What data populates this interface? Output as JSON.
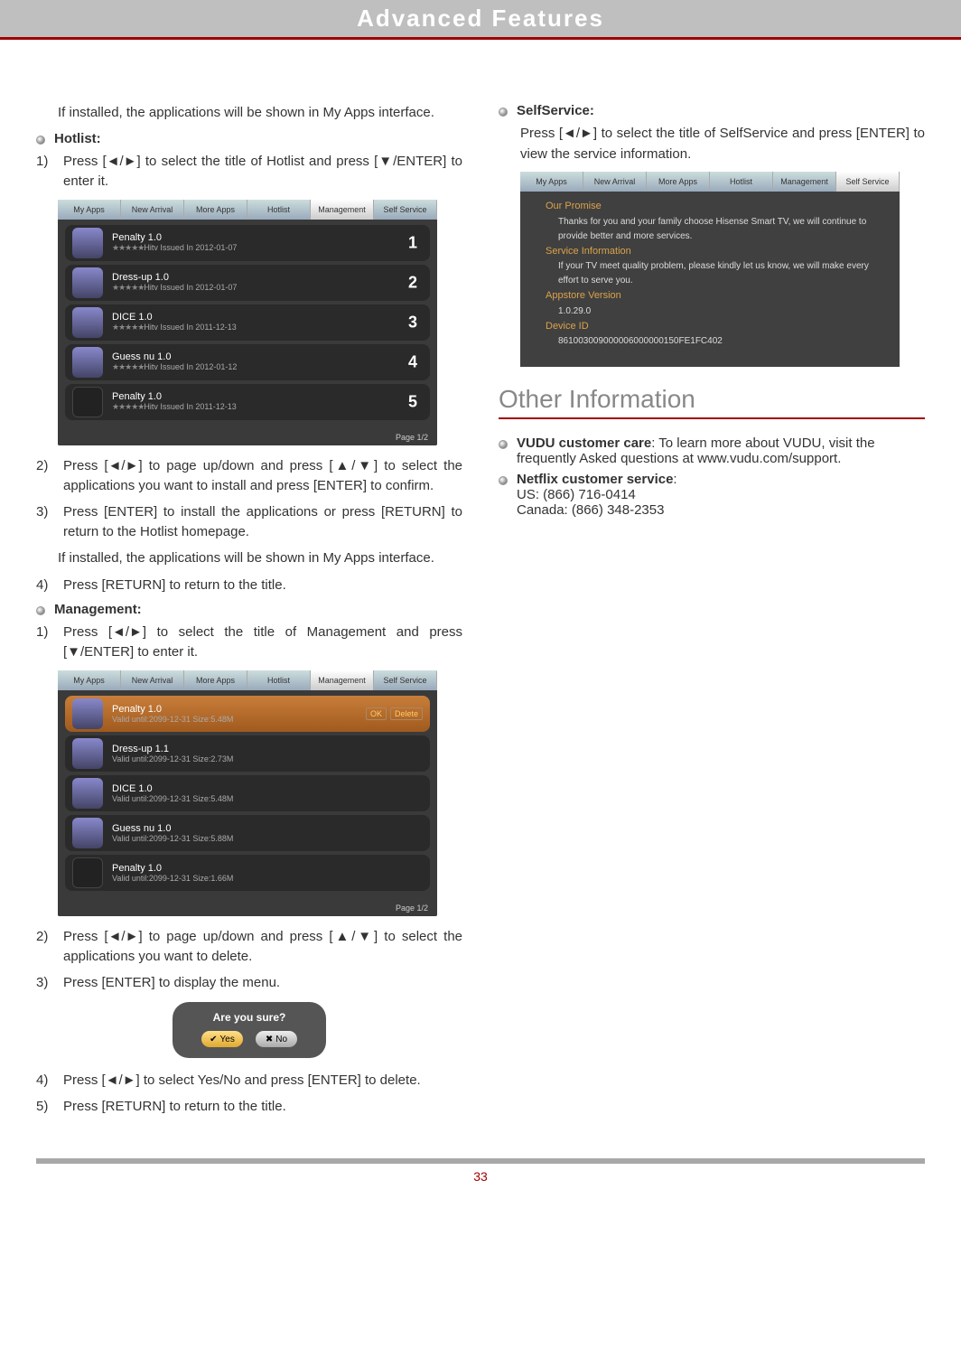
{
  "header": {
    "title": "Advanced Features"
  },
  "col1": {
    "intro": "If installed, the applications will be shown in My Apps interface.",
    "hotlist_label": "Hotlist:",
    "hotlist_step1": "Press [◄/►] to select the title of Hotlist and press [▼/ENTER] to enter it.",
    "hotlist_step2": "Press [◄/►] to page up/down and press [▲/▼] to select the applications you want to install and press [ENTER] to confirm.",
    "hotlist_step3": "Press [ENTER] to install the applications or press [RETURN] to return to the Hotlist homepage.",
    "hotlist_note": "If installed, the applications will be shown in My Apps interface.",
    "hotlist_step4": "Press [RETURN] to return to the title.",
    "mgmt_label": "Management:",
    "mgmt_step1": "Press [◄/►] to select the title of Management and press [▼/ENTER] to enter it.",
    "mgmt_step2": "Press [◄/►] to page up/down and press [▲/▼] to select the applications you want to delete.",
    "mgmt_step3": "Press [ENTER] to display the menu.",
    "mgmt_step4": "Press [◄/►] to select Yes/No and press [ENTER] to delete.",
    "mgmt_step5": "Press [RETURN] to return to the title."
  },
  "tabs": {
    "t1": "My Apps",
    "t2": "New Arrival",
    "t3": "More Apps",
    "t4": "Hotlist",
    "t5": "Management",
    "t6": "Self Service"
  },
  "hotlist_apps": [
    {
      "name": "Penalty  1.0",
      "meta": "Hitv Issued In 2012-01-07",
      "rank": "1",
      "blank": false
    },
    {
      "name": "Dress-up  1.0",
      "meta": "Hitv Issued In 2012-01-07",
      "rank": "2",
      "blank": false
    },
    {
      "name": "DICE  1.0",
      "meta": "Hitv Issued In 2011-12-13",
      "rank": "3",
      "blank": false
    },
    {
      "name": "Guess nu  1.0",
      "meta": "Hitv Issued In 2012-01-12",
      "rank": "4",
      "blank": false
    },
    {
      "name": "Penalty  1.0",
      "meta": "Hitv Issued In 2011-12-13",
      "rank": "5",
      "blank": true
    }
  ],
  "mgmt_apps": [
    {
      "name": "Penalty  1.0",
      "meta": "Valid until:2099-12-31 Size:5.48M",
      "selected": true,
      "blank": false
    },
    {
      "name": "Dress-up  1.1",
      "meta": "Valid until:2099-12-31 Size:2.73M",
      "selected": false,
      "blank": false
    },
    {
      "name": "DICE  1.0",
      "meta": "Valid until:2099-12-31 Size:5.48M",
      "selected": false,
      "blank": false
    },
    {
      "name": "Guess nu  1.0",
      "meta": "Valid until:2099-12-31 Size:5.88M",
      "selected": false,
      "blank": false
    },
    {
      "name": "Penalty  1.0",
      "meta": "Valid until:2099-12-31 Size:1.66M",
      "selected": false,
      "blank": true
    }
  ],
  "pager": "Page  1/2",
  "okdel": {
    "ok": "OK",
    "del": "Delete"
  },
  "dialog": {
    "title": "Are you sure?",
    "yes": "Yes",
    "no": "No"
  },
  "col2": {
    "self_label": "SelfService:",
    "self_text": "Press [◄/►] to select the title of SelfService and press [ENTER] to view the service information.",
    "section": "Other Information",
    "vudu_label": "VUDU customer care",
    "vudu_text": ": To learn more about VUDU, visit the frequently Asked questions at www.vudu.com/support.",
    "netflix_label": "Netflix customer service",
    "netflix_colon": ":",
    "netflix_us": "US: (866) 716-0414",
    "netflix_ca": "Canada: (866) 348-2353"
  },
  "selfservice": {
    "promise_lbl": "Our Promise",
    "promise_txt": "Thanks for you and your family choose Hisense Smart TV, we will continue to provide better and more services.",
    "svc_lbl": "Service Information",
    "svc_txt": "If your TV meet quality problem, please kindly let us know, we will make every effort to serve you.",
    "ver_lbl": "Appstore Version",
    "ver_val": "1.0.29.0",
    "dev_lbl": "Device ID",
    "dev_val": "861003009000006000000150FE1FC402"
  },
  "page_number": "33",
  "stars": "★★★★★"
}
